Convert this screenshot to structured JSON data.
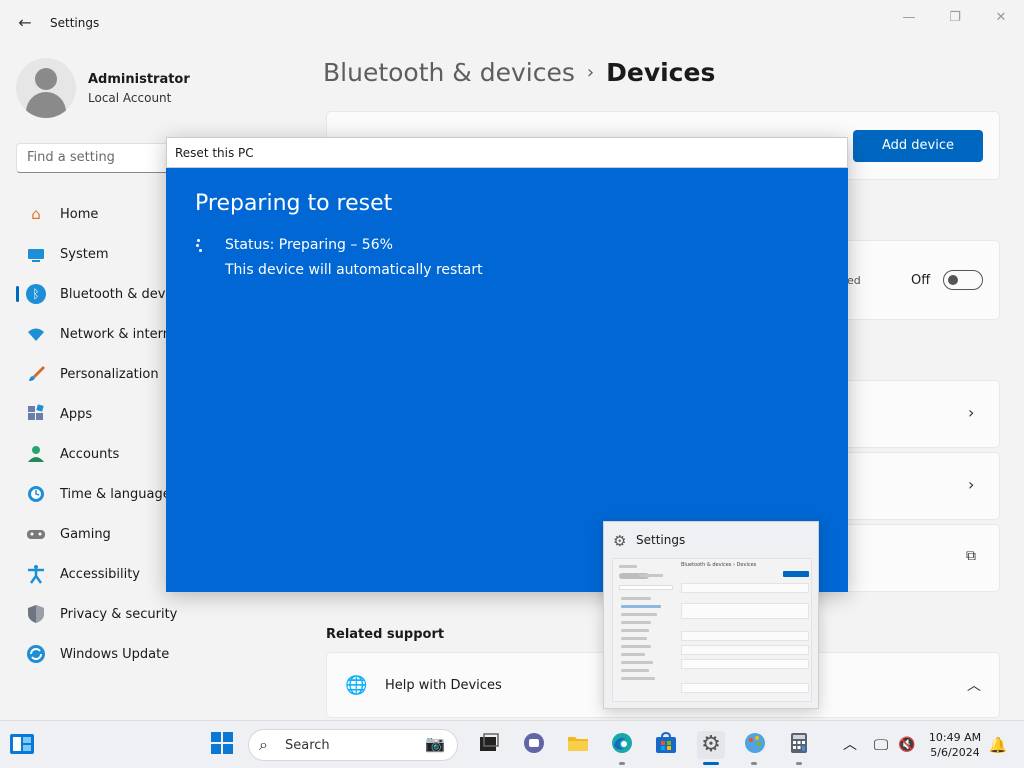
{
  "window": {
    "title": "Settings",
    "back_icon": "arrow-left-icon",
    "minimize_icon": "minimize-icon",
    "maximize_icon": "restore-icon",
    "close_icon": "close-icon"
  },
  "account": {
    "name": "Administrator",
    "type": "Local Account"
  },
  "search": {
    "placeholder": "Find a setting"
  },
  "nav": {
    "items": [
      {
        "label": "Home",
        "icon": "home-icon"
      },
      {
        "label": "System",
        "icon": "system-icon"
      },
      {
        "label": "Bluetooth & devices",
        "icon": "bluetooth-icon",
        "active": true
      },
      {
        "label": "Network & internet",
        "icon": "wifi-icon"
      },
      {
        "label": "Personalization",
        "icon": "brush-icon"
      },
      {
        "label": "Apps",
        "icon": "apps-icon"
      },
      {
        "label": "Accounts",
        "icon": "person-icon"
      },
      {
        "label": "Time & language",
        "icon": "globe-clock-icon"
      },
      {
        "label": "Gaming",
        "icon": "gamepad-icon"
      },
      {
        "label": "Accessibility",
        "icon": "accessibility-icon"
      },
      {
        "label": "Privacy & security",
        "icon": "shield-icon"
      },
      {
        "label": "Windows Update",
        "icon": "update-icon"
      }
    ]
  },
  "page": {
    "parent": "Bluetooth & devices",
    "separator": "›",
    "current": "Devices"
  },
  "main": {
    "add_device_label": "Add device",
    "toggle_partial_label": "ed",
    "toggle_state_label": "Off",
    "related_support_title": "Related support",
    "help_label": "Help with Devices"
  },
  "dialog": {
    "title": "Reset this PC",
    "heading": "Preparing to reset",
    "status": "Status: Preparing – 56%",
    "restart_note": "This device will automatically restart",
    "progress_percent": 56
  },
  "thumbnail": {
    "title": "Settings",
    "mini_heading": "Bluetooth & devices  ›  Devices"
  },
  "taskbar": {
    "search_label": "Search",
    "time": "10:49 AM",
    "date": "5/6/2024"
  },
  "colors": {
    "accent": "#0067c0",
    "dialog_bg": "#0067d4",
    "background": "#f3f3f3"
  }
}
